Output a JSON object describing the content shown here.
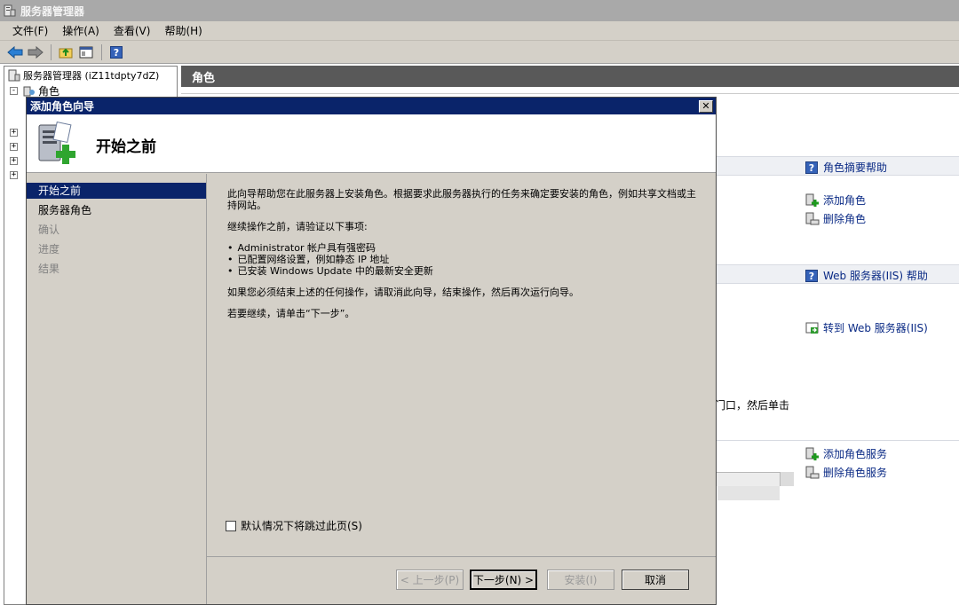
{
  "window": {
    "title": "服务器管理器"
  },
  "menu": [
    "文件(F)",
    "操作(A)",
    "查看(V)",
    "帮助(H)"
  ],
  "toolbar": {
    "icons": [
      "back-arrow-icon",
      "forward-arrow-icon",
      "folder-up-icon",
      "console-view-icon",
      "help-icon"
    ]
  },
  "tree": {
    "root": "服务器管理器 (iZ11tdpty7dZ)",
    "roles": "角色",
    "expanders": [
      "⊞",
      "⊞",
      "⊞",
      "⊞"
    ],
    "collapse": "⊟"
  },
  "content": {
    "header": "角色",
    "actions": {
      "roles_summary_help": "角色摘要帮助",
      "add_role": "添加角色",
      "remove_role": "删除角色",
      "web_help": "Web 服务器(IIS) 帮助",
      "goto_web": "转到 Web 服务器(IIS)",
      "partial_text": "门口，然后单击",
      "add_role_service": "添加角色服务",
      "remove_role_service": "删除角色服务"
    }
  },
  "dialog": {
    "title": "添加角色向导",
    "close": "✕",
    "banner_title": "开始之前",
    "nav": [
      {
        "label": "开始之前",
        "state": "active"
      },
      {
        "label": "服务器角色",
        "state": "normal"
      },
      {
        "label": "确认",
        "state": "dim"
      },
      {
        "label": "进度",
        "state": "dim"
      },
      {
        "label": "结果",
        "state": "dim"
      }
    ],
    "body": {
      "p1": "此向导帮助您在此服务器上安装角色。根据要求此服务器执行的任务来确定要安装的角色，例如共享文档或主持网站。",
      "p2": "继续操作之前，请验证以下事项:",
      "bullets": [
        "Administrator 帐户具有强密码",
        "已配置网络设置，例如静态 IP 地址",
        "已安装 Windows Update 中的最新安全更新"
      ],
      "p3": "如果您必须结束上述的任何操作，请取消此向导，结束操作，然后再次运行向导。",
      "p4": "若要继续，请单击“下一步”。"
    },
    "skip_label": "默认情况下将跳过此页(S)",
    "buttons": {
      "prev": "< 上一步(P)",
      "next": "下一步(N) >",
      "install": "安装(I)",
      "cancel": "取消"
    }
  }
}
